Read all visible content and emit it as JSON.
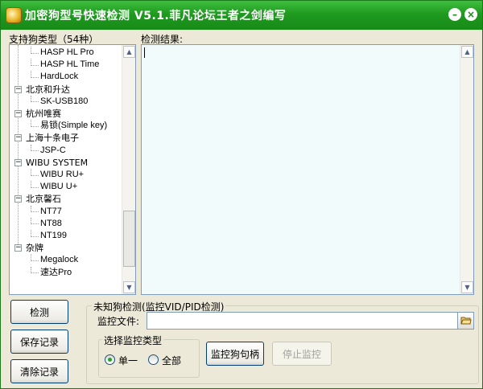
{
  "window": {
    "title": "加密狗型号快速检测 V5.1.菲凡论坛王者之剑编写",
    "minimize_glyph": "–",
    "close_glyph": "×"
  },
  "tree": {
    "label": "支持狗类型（54种）",
    "items": [
      {
        "text": "HASP HL Pro",
        "level": 1
      },
      {
        "text": "HASP HL Time",
        "level": 1
      },
      {
        "text": "HardLock",
        "level": 1
      },
      {
        "text": "北京和升达",
        "level": 0
      },
      {
        "text": "SK-USB180",
        "level": 1
      },
      {
        "text": "杭州唯赛",
        "level": 0
      },
      {
        "text": "易锁(Simple key)",
        "level": 1
      },
      {
        "text": "上海十条电子",
        "level": 0
      },
      {
        "text": "JSP-C",
        "level": 1
      },
      {
        "text": "WIBU SYSTEM",
        "level": 0
      },
      {
        "text": "WIBU RU+",
        "level": 1
      },
      {
        "text": "WIBU U+",
        "level": 1
      },
      {
        "text": "北京馨石",
        "level": 0
      },
      {
        "text": "NT77",
        "level": 1
      },
      {
        "text": "NT88",
        "level": 1
      },
      {
        "text": "NT199",
        "level": 1
      },
      {
        "text": "杂牌",
        "level": 0
      },
      {
        "text": "Megalock",
        "level": 1
      },
      {
        "text": "速达Pro",
        "level": 1
      }
    ]
  },
  "results": {
    "label": "检测结果:",
    "value": ""
  },
  "buttons": {
    "detect": "检测",
    "save_log": "保存记录",
    "clear_log": "清除记录",
    "monitor_handle": "监控狗句柄",
    "stop_monitor": "停止监控"
  },
  "unknown": {
    "group_label": "未知狗检测(监控VID/PID检测)",
    "file_label": "监控文件:",
    "file_value": "",
    "type_group_label": "选择监控类型",
    "radio_single": "单一",
    "radio_all": "全部",
    "selected": "single"
  },
  "colors": {
    "titlebar": "#1f9a1f",
    "results_bg": "#f2fbfb"
  }
}
